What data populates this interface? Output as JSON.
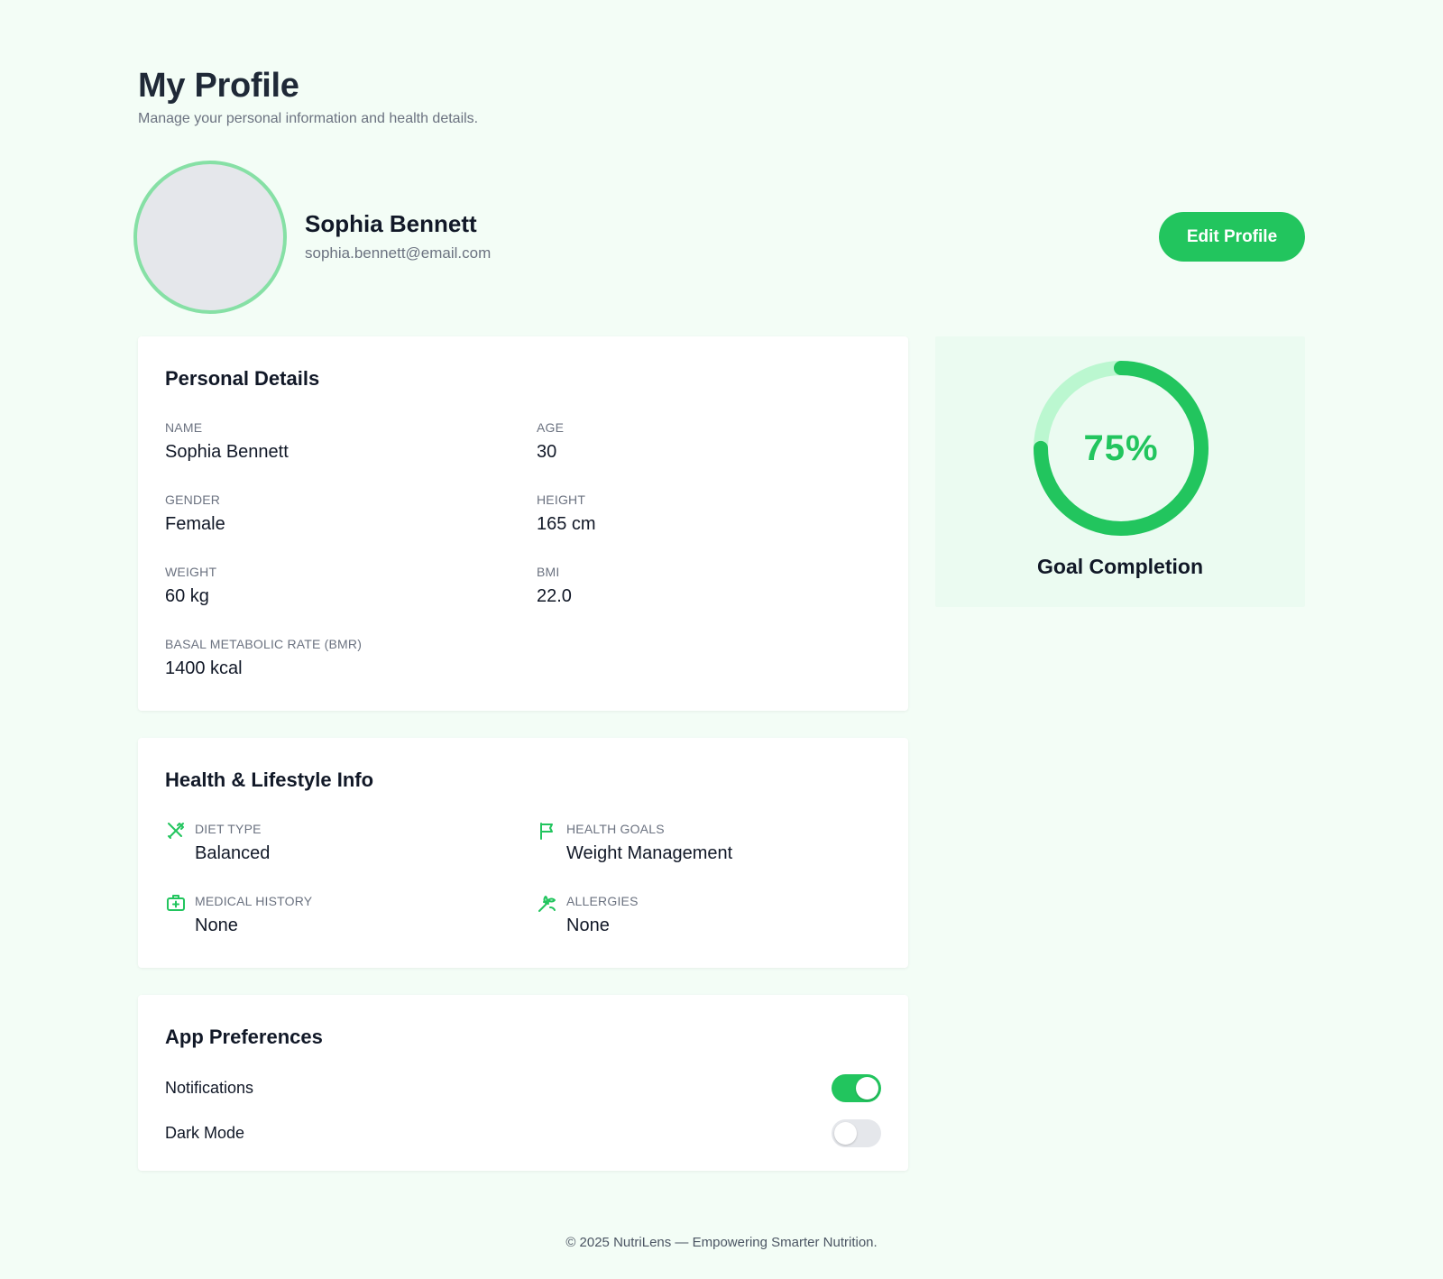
{
  "header": {
    "title": "My Profile",
    "subtitle": "Manage your personal information and health details."
  },
  "profile": {
    "name": "Sophia Bennett",
    "email": "sophia.bennett@email.com",
    "edit_label": "Edit Profile"
  },
  "personal": {
    "title": "Personal Details",
    "fields": [
      {
        "label": "Name",
        "value": "Sophia Bennett"
      },
      {
        "label": "Age",
        "value": "30"
      },
      {
        "label": "Gender",
        "value": "Female"
      },
      {
        "label": "Height",
        "value": "165 cm"
      },
      {
        "label": "Weight",
        "value": "60 kg"
      },
      {
        "label": "BMI",
        "value": "22.0"
      },
      {
        "label": "Basal Metabolic Rate (BMR)",
        "value": "1400 kcal"
      }
    ]
  },
  "health": {
    "title": "Health & Lifestyle Info",
    "fields": [
      {
        "label": "Diet Type",
        "value": "Balanced",
        "icon": "utensils-icon"
      },
      {
        "label": "Health Goals",
        "value": "Weight Management",
        "icon": "flag-icon"
      },
      {
        "label": "Medical History",
        "value": "None",
        "icon": "medical-kit-icon"
      },
      {
        "label": "Allergies",
        "value": "None",
        "icon": "wheat-icon"
      }
    ]
  },
  "preferences": {
    "title": "App Preferences",
    "items": [
      {
        "label": "Notifications",
        "enabled": true
      },
      {
        "label": "Dark Mode",
        "enabled": false
      }
    ]
  },
  "goal": {
    "percent": 75,
    "percent_label": "75%",
    "label": "Goal Completion"
  },
  "colors": {
    "accent": "#22c55e",
    "accent_light": "#bbf7d0",
    "background": "#f3fdf6",
    "goal_card": "#ebfbf1"
  },
  "footer": {
    "text": "© 2025 NutriLens — Empowering Smarter Nutrition."
  }
}
